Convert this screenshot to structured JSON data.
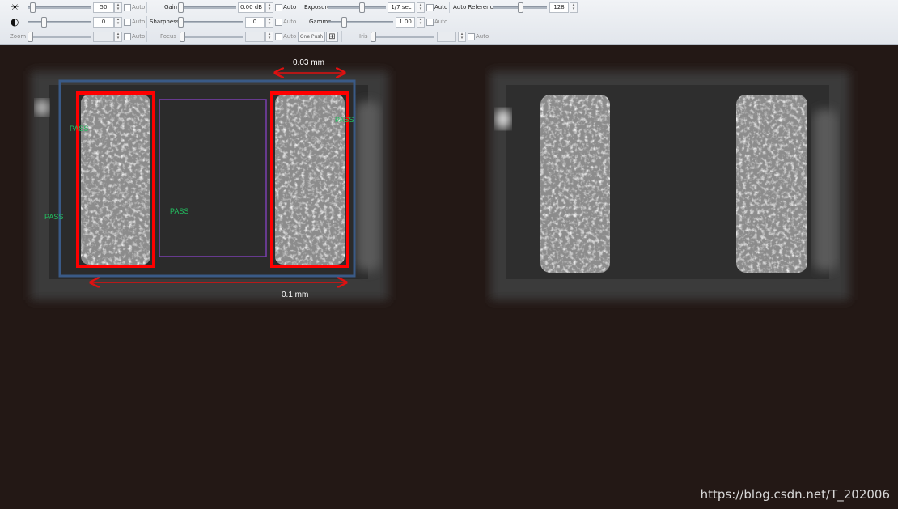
{
  "toolbar": {
    "brightness": {
      "value": "50",
      "auto": "Auto"
    },
    "contrast": {
      "value": "0",
      "auto": "Auto"
    },
    "gain": {
      "label": "Gain",
      "value": "0.00 dB",
      "auto": "Auto"
    },
    "sharpness": {
      "label": "Sharpness",
      "value": "0",
      "auto": "Auto"
    },
    "exposure": {
      "label": "Exposure",
      "value": "1/7 sec",
      "auto": "Auto"
    },
    "gamma": {
      "label": "Gamma",
      "value": "1.00",
      "auto": "Auto"
    },
    "auto_reference": {
      "label": "Auto Reference",
      "value": "128"
    },
    "zoom": {
      "label": "Zoom",
      "auto": "Auto"
    },
    "focus": {
      "label": "Focus",
      "auto": "Auto",
      "one_push": "One Push"
    },
    "iris": {
      "label": "Iris",
      "auto": "Auto"
    }
  },
  "annotations": {
    "dim_top": "0.03 mm",
    "dim_bottom": "0.1 mm",
    "pass_left_top": "PASS",
    "pass_left_mid": "PASS",
    "pass_center": "PASS",
    "pass_right": "PASS",
    "colors": {
      "arrow": "#e01010",
      "outer_box": "#3a5a86",
      "electrode_box": "#ff0000",
      "center_box": "#7a3fb0",
      "pass": "#22c060"
    }
  },
  "watermark": "https://blog.csdn.net/T_202006"
}
